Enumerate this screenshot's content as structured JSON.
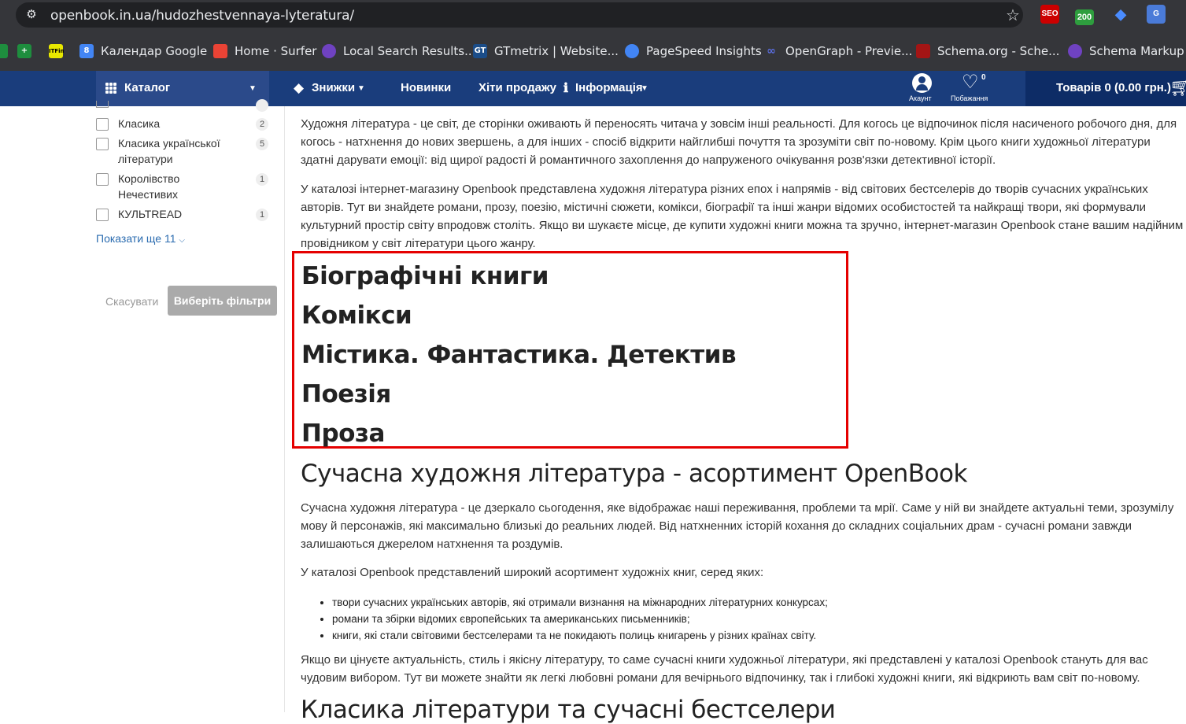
{
  "browser": {
    "url": "openbook.in.ua/hudozhestvennaya-lyteratura/",
    "extensions": [
      "SEO",
      "200"
    ],
    "bookmarks": [
      {
        "label": "",
        "color": "#1e8e3e"
      },
      {
        "label": "",
        "color": "#e8e800"
      },
      {
        "label": "Календар Google",
        "color": "#4285f4"
      },
      {
        "label": "Home · Surfer",
        "color": "#ea4335"
      },
      {
        "label": "Local Search Results...",
        "color": "#6f42c1"
      },
      {
        "label": "GTmetrix | Website...",
        "color": "#1b4d89"
      },
      {
        "label": "PageSpeed Insights",
        "color": "#4285f4"
      },
      {
        "label": "OpenGraph - Previe...",
        "color": "#5b6ee1"
      },
      {
        "label": "Schema.org - Sche...",
        "color": "#a31515"
      },
      {
        "label": "Schema Markup G",
        "color": "#6f42c1"
      }
    ]
  },
  "nav": {
    "catalog": "Каталог",
    "discounts": "Знижки",
    "new": "Новинки",
    "bestsellers": "Хіти продажу",
    "info": "Інформація",
    "account": "Акаунт",
    "wishlist": "Побажання",
    "wishlist_count": "0",
    "cart": "Товарів 0 (0.00 грн.)"
  },
  "sidebar": {
    "filters": [
      {
        "label": "Класика",
        "count": "2"
      },
      {
        "label": "Класика української літератури",
        "count": "5"
      },
      {
        "label": "Королівство Нечестивих",
        "count": "1"
      },
      {
        "label": "КУЛЬТREAD",
        "count": "1"
      }
    ],
    "show_more": "Показати ще 11",
    "cancel": "Скасувати",
    "apply": "Виберіть фільтри"
  },
  "content": {
    "intro1": "Художня література - це світ, де сторінки оживають й переносять читача у зовсім інші реальності. Для когось це відпочинок після насиченого робочого дня, для когось - натхнення до нових звершень, а для інших - спосіб відкрити найглибші почуття та зрозуміти світ по-новому. Крім цього книги художньої літератури здатні дарувати емоції: від щирої радості й романтичного захоплення до напруженого очікування розв'язки детективної історії.",
    "intro2": "У каталозі інтернет-магазину Openbook представлена художня література різних епох і напрямів - від світових бестселерів до творів сучасних українських авторів. Тут ви знайдете романи, прозу, поезію, містичні сюжети, комікси, біографії та інші жанри відомих особистостей та найкращі твори, які формували культурний простір світу впродовж століть. Якщо ви шукаєте місце, де купити художні книги можна та зручно, інтернет-магазин Openbook стане вашим надійним провідником у світ літератури цього жанру.",
    "genres": [
      "Біографічні книги",
      "Комікси",
      "Містика. Фантастика. Детектив",
      "Поезія",
      "Проза"
    ],
    "h2_modern": "Сучасна художня література - асортимент OpenBook",
    "modern1": "Сучасна художня література - це дзеркало сьогодення, яке відображає наші переживання, проблеми та мрії. Саме у ній ви знайдете актуальні теми, зрозумілу мову й персонажів, які максимально близькі до реальних людей. Від натхненних історій кохання до складних соціальних драм - сучасні романи завжди залишаються джерелом натхнення та роздумів.",
    "modern2": "У каталозі Openbook представлений широкий асортимент художніх книг, серед яких:",
    "bullets": [
      "твори сучасних українських авторів, які отримали визнання на міжнародних літературних конкурсах;",
      "романи та збірки відомих європейських та американських письменників;",
      "книги, які стали світовими бестселерами та не покидають полиць книгарень у різних країнах світу."
    ],
    "modern3": "Якщо ви цінуєте актуальність, стиль і якісну літературу, то саме сучасні книги художньої літератури, які представлені у каталозі Openbook стануть для вас чудовим вибором. Тут ви можете знайти як легкі любовні романи для вечірнього відпочинку, так і глибокі художні книги, які відкриють вам світ по-новому.",
    "h2_classic": "Класика літератури та сучасні бестселери"
  }
}
